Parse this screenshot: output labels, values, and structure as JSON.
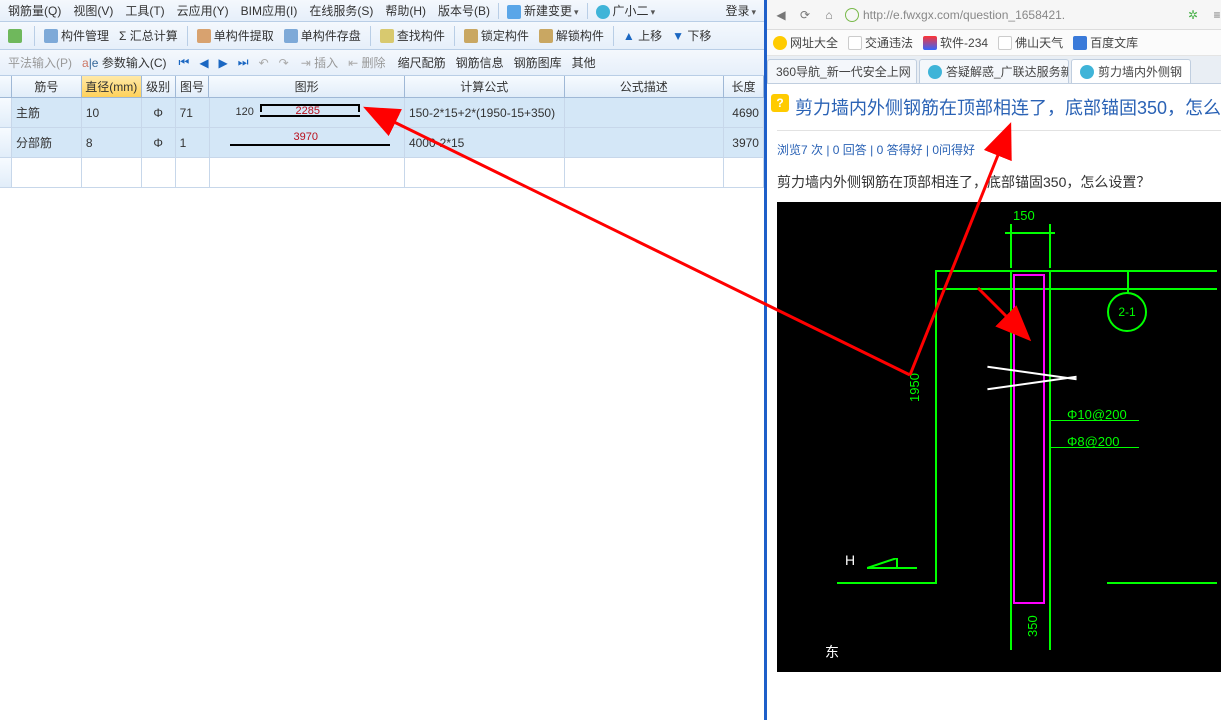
{
  "menu": {
    "items": [
      "钢筋量(Q)",
      "视图(V)",
      "工具(T)",
      "云应用(Y)",
      "BIM应用(I)",
      "在线服务(S)",
      "帮助(H)",
      "版本号(B)"
    ],
    "change": "新建变更",
    "user": "广小二",
    "login": "登录"
  },
  "toolbar1": {
    "items": [
      "构件管理",
      "Σ 汇总计算",
      "单构件提取",
      "单构件存盘",
      "查找构件",
      "锁定构件",
      "解锁构件",
      "上移",
      "下移"
    ]
  },
  "toolbar2": {
    "items": [
      "平法输入(P)",
      "参数输入(C)"
    ],
    "nav": [
      "⏮",
      "◀",
      "▶",
      "⏭",
      "↶",
      "↷"
    ],
    "edit": [
      "插入",
      "删除"
    ],
    "right": [
      "缩尺配筋",
      "钢筋信息",
      "钢筋图库",
      "其他"
    ]
  },
  "table": {
    "cols": [
      "筋号",
      "直径(mm)",
      "级别",
      "图号",
      "图形",
      "计算公式",
      "公式描述",
      "长度"
    ],
    "rows": [
      {
        "a": "主筋",
        "b": "10",
        "c": "Φ",
        "d": "71",
        "shape": {
          "left": "120",
          "main": "2285"
        },
        "f": "150-2*15+2*(1950-15+350)",
        "g": "",
        "h": "4690"
      },
      {
        "a": "分部筋",
        "b": "8",
        "c": "Φ",
        "d": "1",
        "shape": {
          "main": "3970"
        },
        "f": "4000-2*15",
        "g": "",
        "h": "3970"
      }
    ]
  },
  "browser": {
    "url": "http://e.fwxgx.com/question_1658421.",
    "bookmarks": [
      "网址大全",
      "交通违法",
      "软件-234",
      "佛山天气",
      "百度文库"
    ],
    "tabs": [
      "360导航_新一代安全上网",
      "答疑解惑_广联达服务新…",
      "剪力墙内外侧钢"
    ],
    "title": "剪力墙内外侧钢筋在顶部相连了，底部锚固350，怎么",
    "meta": "浏览7 次 | 0 回答 | 0 答得好 | 0问得好",
    "body": "剪力墙内外侧钢筋在顶部相连了，底部锚固350，怎么设置？",
    "cad": {
      "dim150": "150",
      "dim1950": "1950",
      "dim350": "350",
      "phi1": "Φ10@200",
      "phi2": "Φ8@200",
      "section": "2-1",
      "letterH": "H",
      "letterDong": "东"
    }
  }
}
